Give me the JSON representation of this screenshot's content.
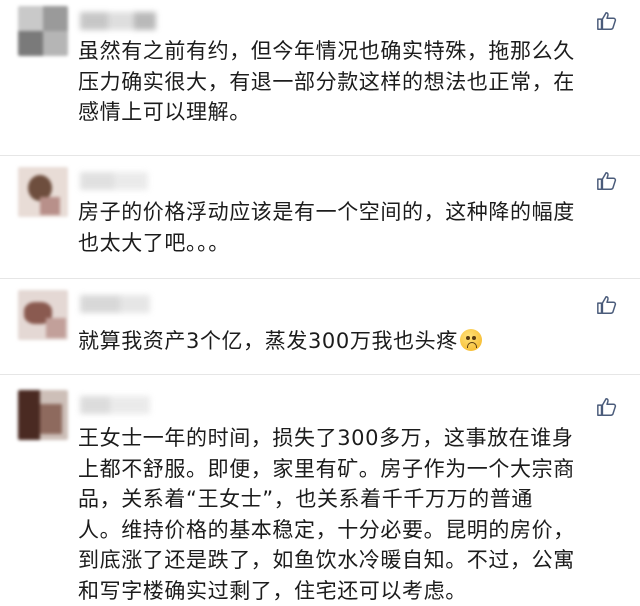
{
  "comments": [
    {
      "text": "虽然有之前有约，但今年情况也确实特殊，拖那么久\n压力确实很大，有退一部分款这样的想法也正常，在\n感情上可以理解。"
    },
    {
      "text": "房子的价格浮动应该是有一个空间的，这种降的幅度\n也太大了吧。。。"
    },
    {
      "text": "就算我资产3个亿，蒸发300万我也头疼"
    },
    {
      "text": "王女士一年的时间，损失了300多万，这事放在谁身\n上都不舒服。即便，家里有矿。房子作为一个大宗商\n品，关系着“王女士”，也关系着千千万万的普通\n人。维持价格的基本稳定，十分必要。昆明的房价，\n到底涨了还是跌了，如鱼饮水冷暖自知。不过，公寓\n和写字楼确实过剩了，住宅还可以考虑。"
    }
  ],
  "icons": {
    "like": "thumbs-up-icon",
    "emoji": "smiling-face-emoji-icon"
  }
}
